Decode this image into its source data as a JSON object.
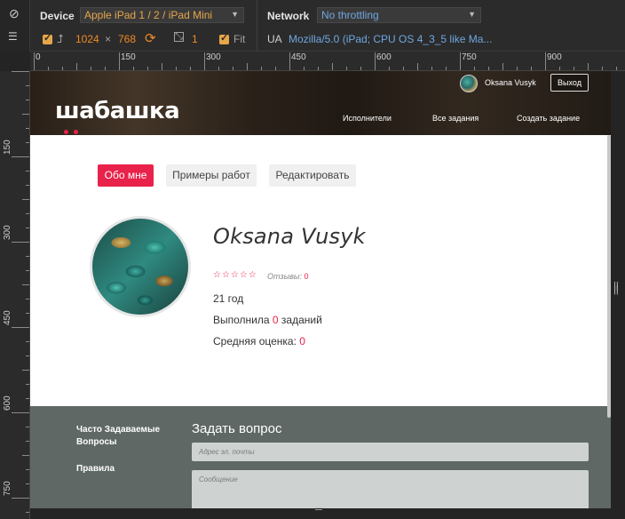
{
  "devtools": {
    "device_label": "Device",
    "device_value": "Apple iPad 1 / 2 / iPad Mini",
    "width": "1024",
    "times": "×",
    "height": "768",
    "scale": "1",
    "fit_label": "Fit",
    "network_label": "Network",
    "network_value": "No throttling",
    "ua_label": "UA",
    "ua_value": "Mozilla/5.0 (iPad; CPU OS 4_3_5 like Ma..."
  },
  "ruler": {
    "top_labels": [
      "0",
      "150",
      "300",
      "450",
      "600",
      "750",
      "900"
    ],
    "left_labels": [
      "150",
      "300",
      "450",
      "600",
      "750"
    ]
  },
  "site": {
    "logo": "шабашка",
    "user_name": "Oksana Vusyk",
    "logout": "Выход",
    "nav": [
      "Исполнители",
      "Все задания",
      "Создать задание"
    ]
  },
  "tabs": [
    "Обо мне",
    "Примеры работ",
    "Редактировать"
  ],
  "profile": {
    "name": "Oksana Vusyk",
    "stars": "☆☆☆☆☆",
    "reviews_label": "Отзывы:",
    "reviews_count": "0",
    "age": "21 год",
    "completed_prefix": "Выполнила",
    "completed_count": "0",
    "completed_suffix": "заданий",
    "rating_label": "Средняя оценка:",
    "rating_value": "0"
  },
  "footer": {
    "faq_line1": "Часто Задаваемые",
    "faq_line2": "Вопросы",
    "rules": "Правила",
    "ask_title": "Задать вопрос",
    "email_placeholder": "Адрес эл. почты",
    "message_placeholder": "Сообщение"
  },
  "colors": {
    "accent": "#e8224a",
    "devtools_orange": "#f08a24",
    "devtools_blue": "#6fa7e0",
    "footer_bg": "#5f6865"
  }
}
